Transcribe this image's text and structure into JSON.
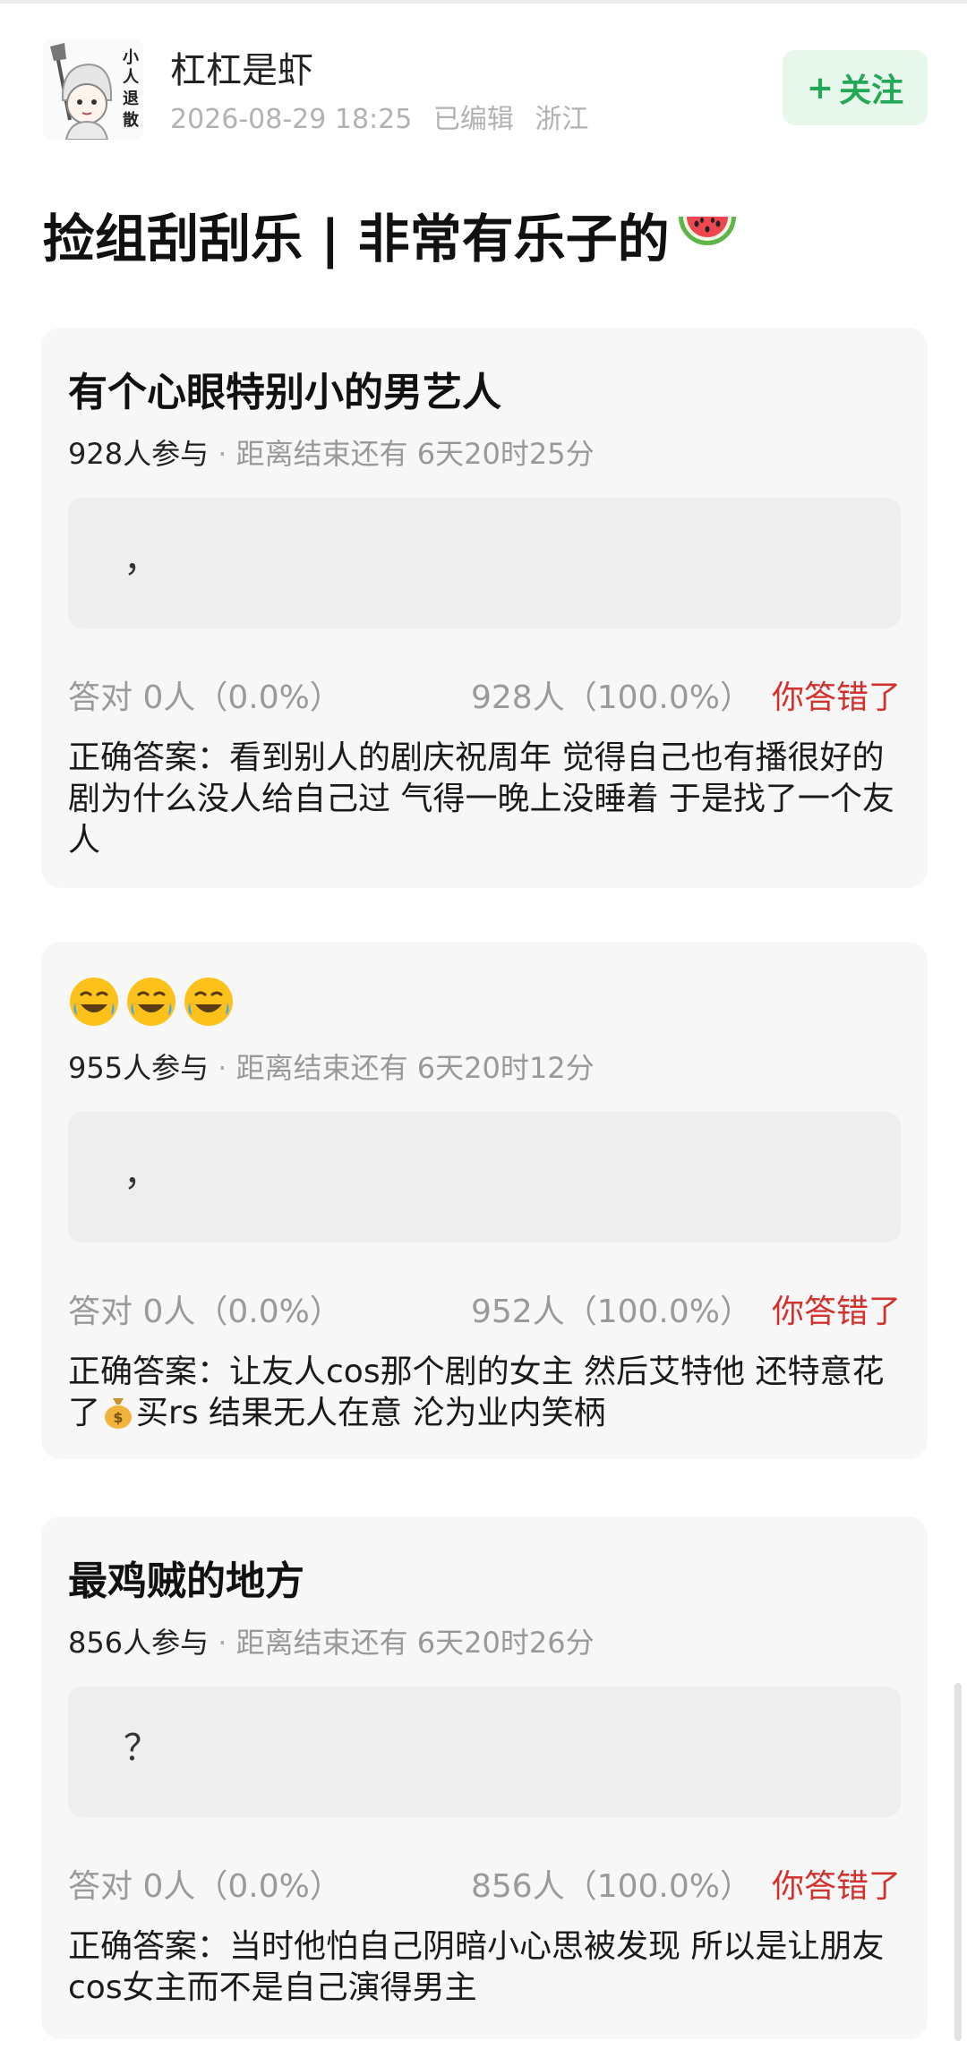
{
  "author": {
    "name": "杠杠是虾",
    "avatar_text": "小人退散",
    "date": "2026-08-29 18:25",
    "edited": "已编辑",
    "location": "浙江",
    "follow_label": "关注",
    "follow_plus": "+"
  },
  "post": {
    "title": "捡组刮刮乐 | 非常有乐子的"
  },
  "quizzes": [
    {
      "question": "有个心眼特别小的男艺人",
      "participants": "928人参与",
      "separator": " · ",
      "remaining": "距离结束还有 6天20时25分",
      "answer_text": "，",
      "correct_stat": "答对  0人（0.0%）",
      "wrong_stat": "928人（100.0%）",
      "result": "你答错了",
      "explanation": "正确答案：看到别人的剧庆祝周年 觉得自己也有播很好的剧为什么没人给自己过 气得一晚上没睡着 于是找了一个友人"
    },
    {
      "question": "",
      "participants": "955人参与",
      "separator": " · ",
      "remaining": "距离结束还有 6天20时12分",
      "answer_text": "，",
      "correct_stat": "答对  0人（0.0%）",
      "wrong_stat": "952人（100.0%）",
      "result": "你答错了",
      "explanation_part1": "正确答案：让友人cos那个剧的女主 然后艾特他 还特意花了",
      "explanation_part2": "买rs 结果无人在意 沦为业内笑柄"
    },
    {
      "question": "最鸡贼的地方",
      "participants": "856人参与",
      "separator": " · ",
      "remaining": "距离结束还有 6天20时26分",
      "answer_text": "？",
      "correct_stat": "答对  0人（0.0%）",
      "wrong_stat": "856人（100.0%）",
      "result": "你答错了",
      "explanation": "正确答案：当时他怕自己阴暗小心思被发现 所以是让朋友cos女主而不是自己演得男主"
    }
  ],
  "icons": {
    "title_emoji": "watermelon-icon",
    "laugh_emoji": "rolling-laughing-icon",
    "money_emoji": "money-bag-icon"
  },
  "colors": {
    "follow_green": "#23a855",
    "wrong_red": "#d2322d",
    "card_bg": "#f7f7f7"
  }
}
